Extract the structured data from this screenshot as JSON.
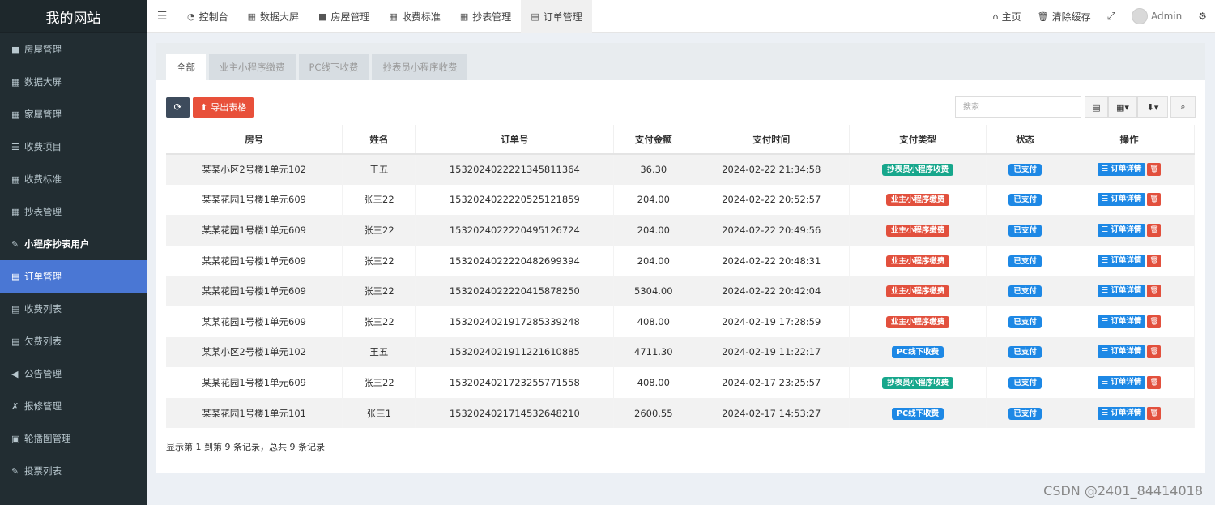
{
  "site_title": "我的网站",
  "sidebar": {
    "items": [
      {
        "icon": "■",
        "icon_name": "house-icon",
        "label": "房屋管理"
      },
      {
        "icon": "▦",
        "icon_name": "table-icon",
        "label": "数据大屏"
      },
      {
        "icon": "▦",
        "icon_name": "table-icon",
        "label": "家属管理"
      },
      {
        "icon": "☰",
        "icon_name": "list-icon",
        "label": "收费项目"
      },
      {
        "icon": "▦",
        "icon_name": "table-icon",
        "label": "收费标准"
      },
      {
        "icon": "▦",
        "icon_name": "table-icon",
        "label": "抄表管理"
      },
      {
        "icon": "✎",
        "icon_name": "edit-icon",
        "label": "小程序抄表用户"
      },
      {
        "icon": "▤",
        "icon_name": "list-alt-icon",
        "label": "订单管理"
      },
      {
        "icon": "▤",
        "icon_name": "list-alt-icon",
        "label": "收费列表"
      },
      {
        "icon": "▤",
        "icon_name": "list-alt-icon",
        "label": "欠费列表"
      },
      {
        "icon": "◀",
        "icon_name": "bullhorn-icon",
        "label": "公告管理"
      },
      {
        "icon": "✗",
        "icon_name": "wrench-icon",
        "label": "报修管理"
      },
      {
        "icon": "▣",
        "icon_name": "image-icon",
        "label": "轮播图管理"
      },
      {
        "icon": "✎",
        "icon_name": "edit-icon",
        "label": "投票列表"
      }
    ]
  },
  "topnav": {
    "tabs": [
      {
        "icon": "◔",
        "icon_name": "dashboard-icon",
        "label": "控制台"
      },
      {
        "icon": "▦",
        "icon_name": "table-icon",
        "label": "数据大屏"
      },
      {
        "icon": "■",
        "icon_name": "house-icon",
        "label": "房屋管理"
      },
      {
        "icon": "▦",
        "icon_name": "table-icon",
        "label": "收费标准"
      },
      {
        "icon": "▦",
        "icon_name": "table-icon",
        "label": "抄表管理"
      },
      {
        "icon": "▤",
        "icon_name": "list-alt-icon",
        "label": "订单管理"
      }
    ],
    "home": "主页",
    "clear_cache": "清除缓存",
    "user": "Admin"
  },
  "subtabs": [
    "全部",
    "业主小程序缴费",
    "PC线下收费",
    "抄表员小程序收费"
  ],
  "toolbar": {
    "export_label": "导出表格",
    "search_placeholder": "搜索"
  },
  "table": {
    "headers": [
      "房号",
      "姓名",
      "订单号",
      "支付金额",
      "支付时间",
      "支付类型",
      "状态",
      "操作"
    ],
    "detail_label": "订单详情",
    "rows": [
      {
        "room": "某某小区2号楼1单元102",
        "name": "王五",
        "order": "15320240222213458113​64",
        "amount": "36.30",
        "time": "2024-02-22 21:34:58",
        "type": "抄表员小程序收费",
        "type_color": "green",
        "status": "已支付"
      },
      {
        "room": "某某花园1号楼1单元609",
        "name": "张三22",
        "order": "153202402222052512​1859",
        "amount": "204.00",
        "time": "2024-02-22 20:52:57",
        "type": "业主小程序缴费",
        "type_color": "red",
        "status": "已支付"
      },
      {
        "room": "某某花园1号楼1单元609",
        "name": "张三22",
        "order": "1532024022220495126724",
        "amount": "204.00",
        "time": "2024-02-22 20:49:56",
        "type": "业主小程序缴费",
        "type_color": "red",
        "status": "已支付"
      },
      {
        "room": "某某花园1号楼1单元609",
        "name": "张三22",
        "order": "1532024022220482699394",
        "amount": "204.00",
        "time": "2024-02-22 20:48:31",
        "type": "业主小程序缴费",
        "type_color": "red",
        "status": "已支付"
      },
      {
        "room": "某某花园1号楼1单元609",
        "name": "张三22",
        "order": "1532024022220415878250",
        "amount": "5304.00",
        "time": "2024-02-22 20:42:04",
        "type": "业主小程序缴费",
        "type_color": "red",
        "status": "已支付"
      },
      {
        "room": "某某花园1号楼1单元609",
        "name": "张三22",
        "order": "1532024021917285339248",
        "amount": "408.00",
        "time": "2024-02-19 17:28:59",
        "type": "业主小程序缴费",
        "type_color": "red",
        "status": "已支付"
      },
      {
        "room": "某某小区2号楼1单元102",
        "name": "王五",
        "order": "1532024021911221610885",
        "amount": "4711.30",
        "time": "2024-02-19 11:22:17",
        "type": "PC线下收费",
        "type_color": "blue",
        "status": "已支付"
      },
      {
        "room": "某某花园1号楼1单元609",
        "name": "张三22",
        "order": "1532024021723255771558",
        "amount": "408.00",
        "time": "2024-02-17 23:25:57",
        "type": "抄表员小程序收费",
        "type_color": "green",
        "status": "已支付"
      },
      {
        "room": "某某花园1号楼1单元101",
        "name": "张三1",
        "order": "1532024021714532648210",
        "amount": "2600.55",
        "time": "2024-02-17 14:53:27",
        "type": "PC线下收费",
        "type_color": "blue",
        "status": "已支付"
      }
    ]
  },
  "pager_text": "显示第 1 到第 9 条记录，总共 9 条记录",
  "watermark": "CSDN @2401_84414018"
}
